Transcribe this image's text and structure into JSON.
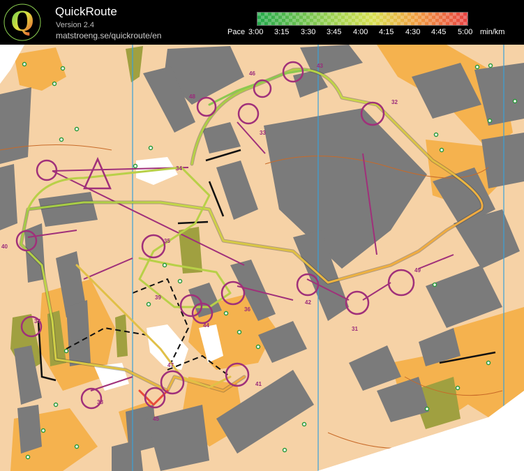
{
  "app": {
    "title": "QuickRoute",
    "version": "Version 2.4",
    "url": "matstroeng.se/quickroute/en",
    "logo_letter": "Q"
  },
  "pace_scale": {
    "label": "Pace",
    "ticks": [
      "3:00",
      "3:15",
      "3:30",
      "3:45",
      "4:00",
      "4:15",
      "4:30",
      "4:45",
      "5:00"
    ],
    "unit": "min/km",
    "colors": [
      "#22a84a",
      "#8cd050",
      "#d8e050",
      "#f0a040",
      "#e84040"
    ]
  },
  "map": {
    "colors": {
      "open": "#f6d2a6",
      "rough": "#f5b24e",
      "forest": "#ffffff",
      "building": "#777777",
      "course": "#a0307a",
      "north_line": "#3aa0d8"
    },
    "controls": [
      {
        "label": "31"
      },
      {
        "label": "32"
      },
      {
        "label": "33"
      },
      {
        "label": "34"
      },
      {
        "label": "35"
      },
      {
        "label": "36"
      },
      {
        "label": "37"
      },
      {
        "label": "38"
      },
      {
        "label": "39"
      },
      {
        "label": "40"
      },
      {
        "label": "41"
      },
      {
        "label": "42"
      },
      {
        "label": "43"
      },
      {
        "label": "44"
      },
      {
        "label": "45"
      },
      {
        "label": "46"
      },
      {
        "label": "47"
      },
      {
        "label": "48"
      },
      {
        "label": "49"
      }
    ]
  }
}
